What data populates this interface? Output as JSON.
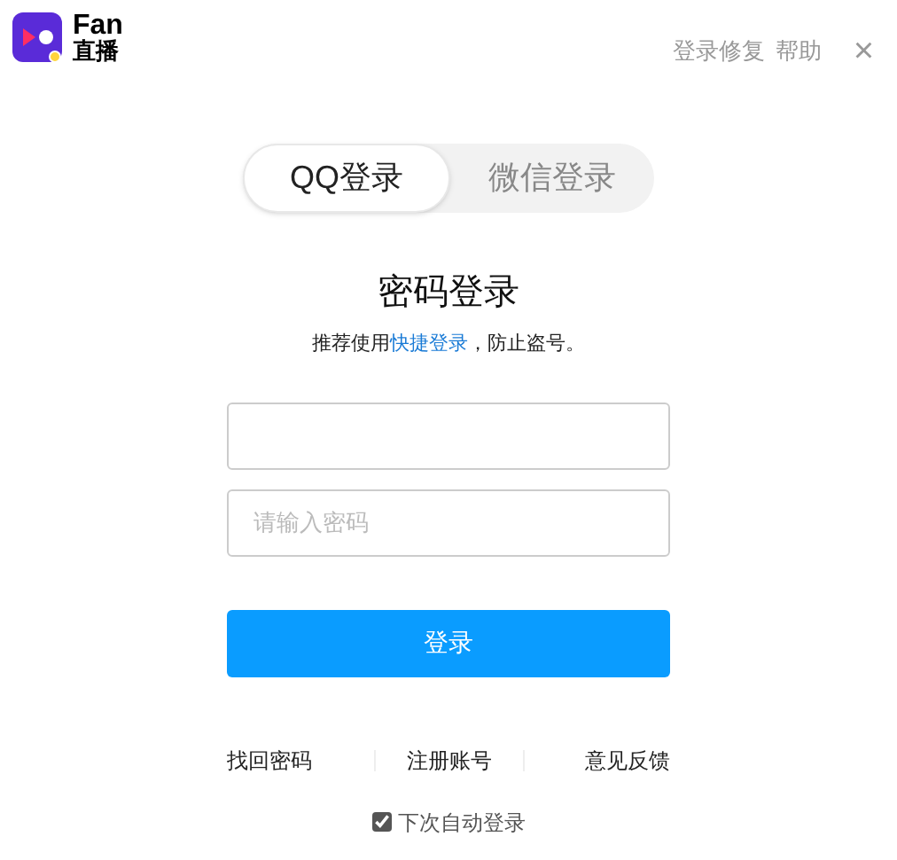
{
  "brand": {
    "name": "Fan",
    "subtitle": "直播"
  },
  "top_links": [
    "登录修复",
    "帮助"
  ],
  "close": "×",
  "tabs": [
    {
      "label": "QQ登录",
      "selected": true
    },
    {
      "label": "微信登录",
      "selected": false
    }
  ],
  "title": "密码登录",
  "hint": {
    "before": "推荐使用",
    "link": "快捷登录",
    "after": "，防止盗号。"
  },
  "password": {
    "placeholder": "请输入密码"
  },
  "login_button": "登录",
  "footer_links": [
    "找回密码",
    "注册账号",
    "意见反馈"
  ],
  "auto_login": {
    "label": "下次自动登录",
    "checked": true
  }
}
